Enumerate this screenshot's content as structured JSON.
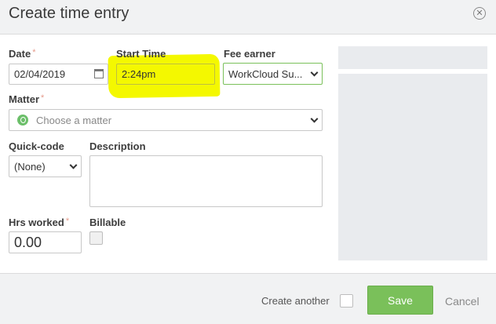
{
  "dialog": {
    "title": "Create time entry",
    "close_icon": "close-circle-icon"
  },
  "form": {
    "date": {
      "label": "Date",
      "value": "02/04/2019",
      "icon": "calendar-icon"
    },
    "start_time": {
      "label": "Start Time",
      "value": "2:24pm"
    },
    "fee_earner": {
      "label": "Fee earner",
      "value": "WorkCloud Su..."
    },
    "matter": {
      "label": "Matter",
      "placeholder": "Choose a matter",
      "icon": "matter-icon"
    },
    "quick_code": {
      "label": "Quick-code",
      "value": "(None)"
    },
    "description": {
      "label": "Description",
      "value": ""
    },
    "hrs_worked": {
      "label": "Hrs worked",
      "value": "0.00"
    },
    "billable": {
      "label": "Billable",
      "checked": false
    },
    "required_marker": "*"
  },
  "footer": {
    "create_another_label": "Create another",
    "create_another_checked": false,
    "save_label": "Save",
    "cancel_label": "Cancel"
  },
  "colors": {
    "save_button": "#7ac05a",
    "highlight": "#f4f800",
    "fee_earner_border": "#7ac05a"
  }
}
